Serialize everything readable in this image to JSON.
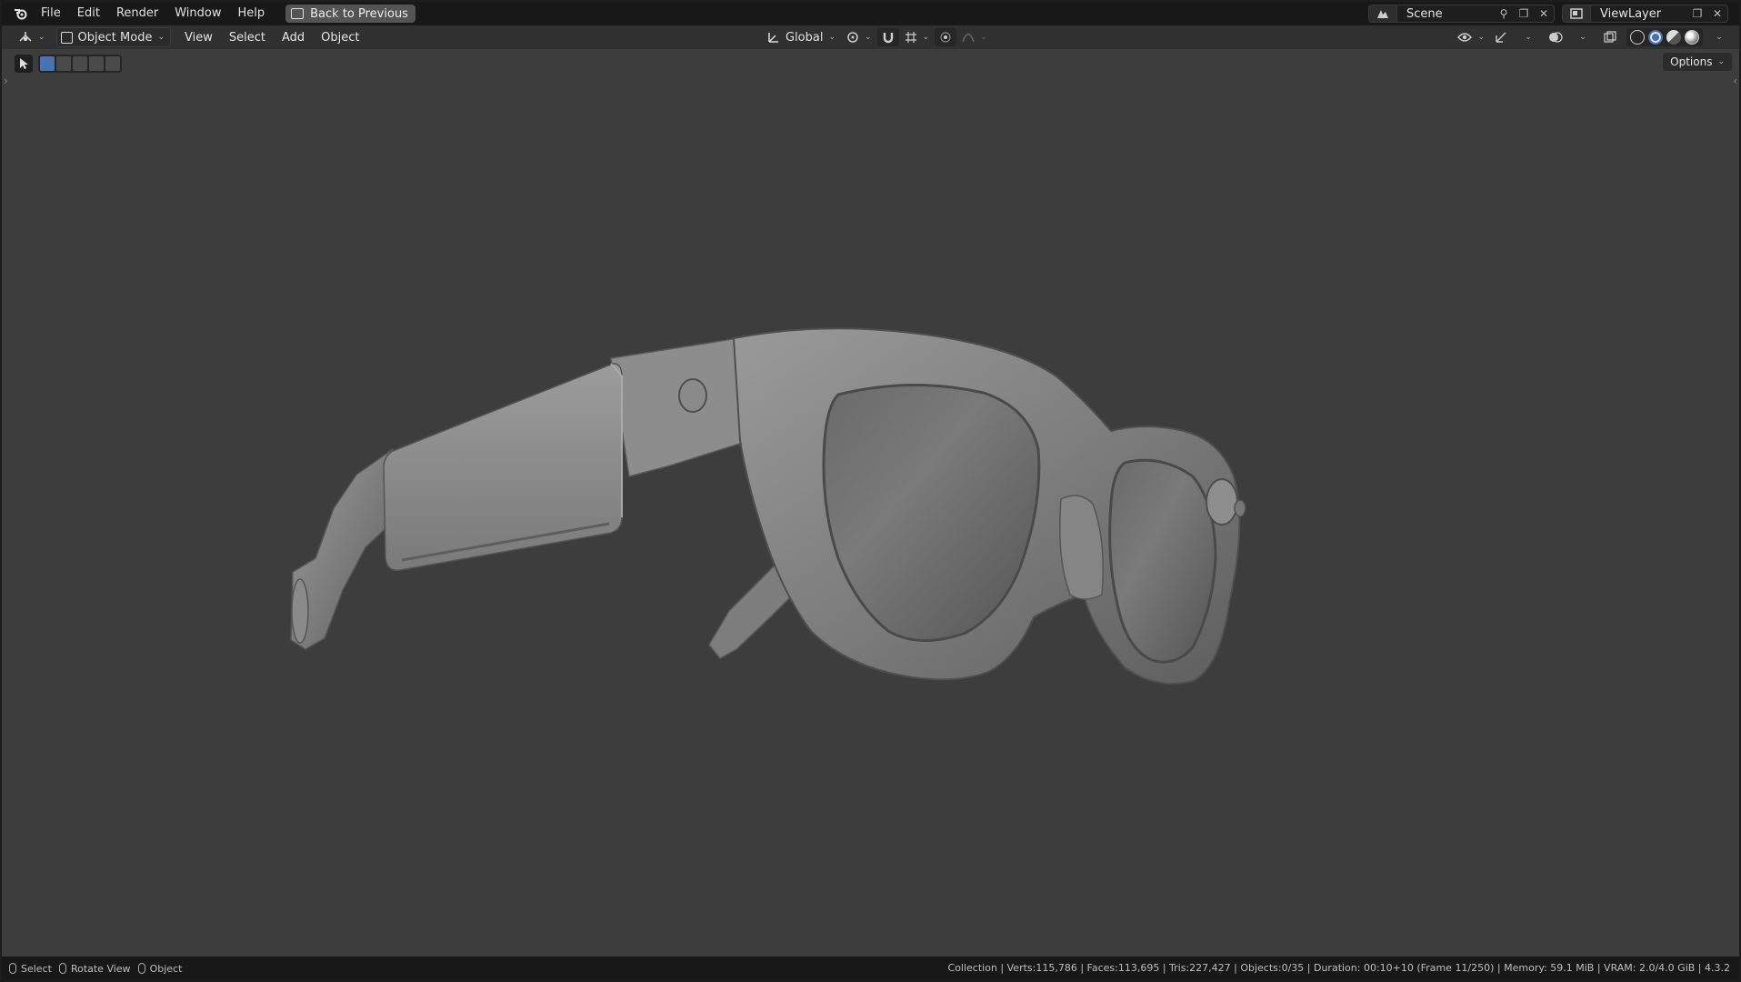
{
  "topbar": {
    "menus": [
      "File",
      "Edit",
      "Render",
      "Window",
      "Help"
    ],
    "back_button": "Back to Previous",
    "scene": "Scene",
    "view_layer": "ViewLayer"
  },
  "header": {
    "mode": "Object Mode",
    "menus": [
      "View",
      "Select",
      "Add",
      "Object"
    ],
    "transform_orientation": "Global"
  },
  "viewport": {
    "options_label": "Options"
  },
  "statusbar": {
    "hints": [
      "Select",
      "Rotate View",
      "Object"
    ],
    "stats": "Collection | Verts:115,786 | Faces:113,695 | Tris:227,427 | Objects:0/35 | Duration: 00:10+10 (Frame 11/250) | Memory: 59.1 MiB | VRAM: 2.0/4.0 GiB | 4.3.2"
  },
  "colors": {
    "topbar_bg": "#181818",
    "header_bg": "#303030",
    "viewport_bg": "#3d3d3d",
    "selection_accent": "#4772b3"
  }
}
